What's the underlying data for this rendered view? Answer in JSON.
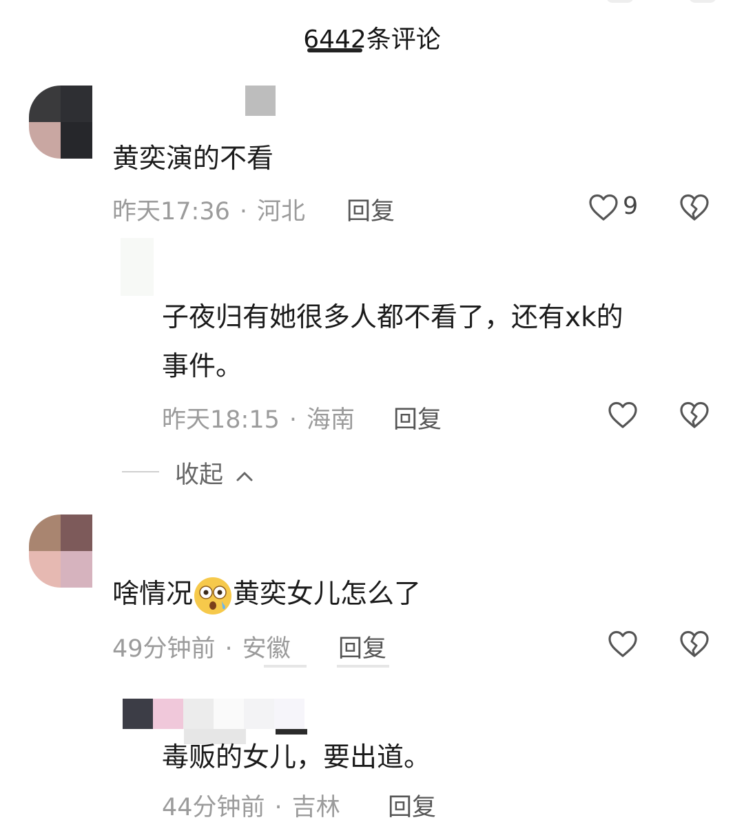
{
  "header": {
    "title": "6442条评论"
  },
  "comments": [
    {
      "text": "黄奕演的不看",
      "time": "昨天17:36",
      "location": "河北",
      "reply_label": "回复",
      "likes": "9"
    },
    {
      "text_line1": "子夜归有她很多人都不看了，还有xk的",
      "text_line2": "事件。",
      "time": "昨天18:15",
      "location": "海南",
      "reply_label": "回复"
    },
    {
      "text_before": "啥情况",
      "text_after": "黄奕女儿怎么了",
      "time": "49分钟前",
      "location": "安徽",
      "reply_label": "回复"
    },
    {
      "text": "毒贩的女儿，要出道。",
      "time": "44分钟前",
      "location": "吉林",
      "reply_label": "回复"
    }
  ],
  "collapse": {
    "label": "收起"
  },
  "meta_separator": "·",
  "icons": {
    "like": "heart-outline-icon",
    "dislike": "broken-heart-icon",
    "collapse": "chevron-up-icon",
    "emoji": "shocked-face-emoji"
  },
  "colors": {
    "text": "#1b1b1b",
    "meta": "#9b9b9b",
    "icon": "#555555"
  }
}
